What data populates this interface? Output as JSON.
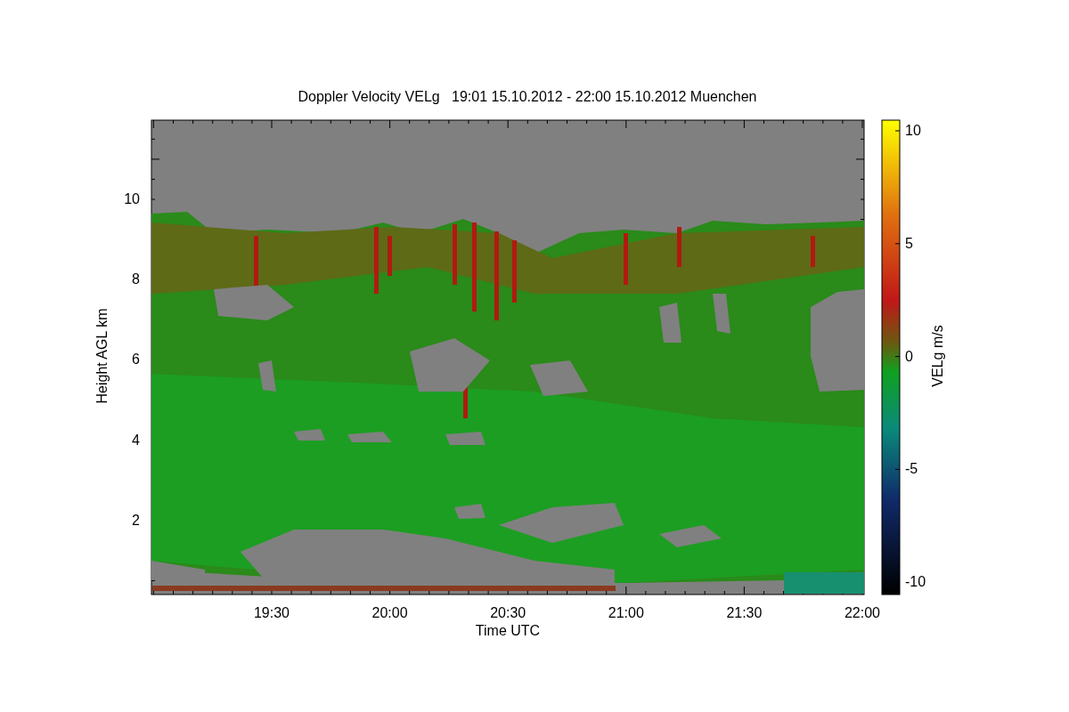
{
  "title": "Doppler Velocity VELg   19:01 15.10.2012 - 22:00 15.10.2012 Muenchen",
  "y_axis": {
    "label": "Height AGL km",
    "ticks": [
      "10",
      "8",
      "6",
      "4",
      "2"
    ]
  },
  "x_axis": {
    "label": "Time UTC",
    "ticks": [
      "19:30",
      "20:00",
      "20:30",
      "21:00",
      "21:30",
      "22:00"
    ]
  },
  "colorbar": {
    "label": "VELg m/s",
    "ticks": [
      "10",
      "5",
      "0",
      "-5",
      "-10"
    ]
  }
}
